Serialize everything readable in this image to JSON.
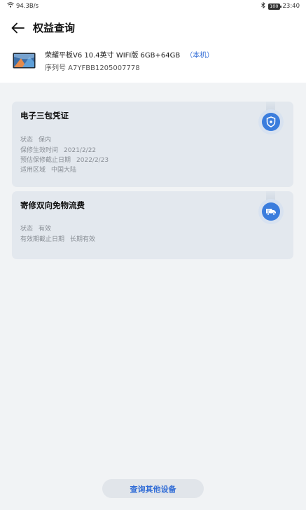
{
  "status_bar": {
    "speed": "94.3B/s",
    "battery": "100",
    "time": "23:40"
  },
  "header": {
    "title": "权益查询"
  },
  "device": {
    "name": "荣耀平板V6 10.4英寸 WIFI版 6GB+64GB",
    "tag": "（本机）",
    "serial": "序列号 A7YFBB1205007778"
  },
  "cards": [
    {
      "title": "电子三包凭证",
      "icon": "shield-icon",
      "rows": [
        {
          "label": "状态",
          "value": "保内"
        },
        {
          "label": "保修生效时间",
          "value": "2021/2/22"
        },
        {
          "label": "预估保修截止日期",
          "value": "2022/2/23"
        },
        {
          "label": "适用区域",
          "value": "中国大陆"
        }
      ]
    },
    {
      "title": "寄修双向免物流费",
      "icon": "truck-icon",
      "rows": [
        {
          "label": "状态",
          "value": "有效"
        },
        {
          "label": "有效期截止日期",
          "value": "长期有效"
        }
      ]
    }
  ],
  "bottom_button": {
    "label": "查询其他设备"
  },
  "colors": {
    "accent": "#2f6bd6",
    "badge": "#3b7ddd",
    "card_bg": "#e3e8ee",
    "page_bg": "#f1f3f5"
  }
}
